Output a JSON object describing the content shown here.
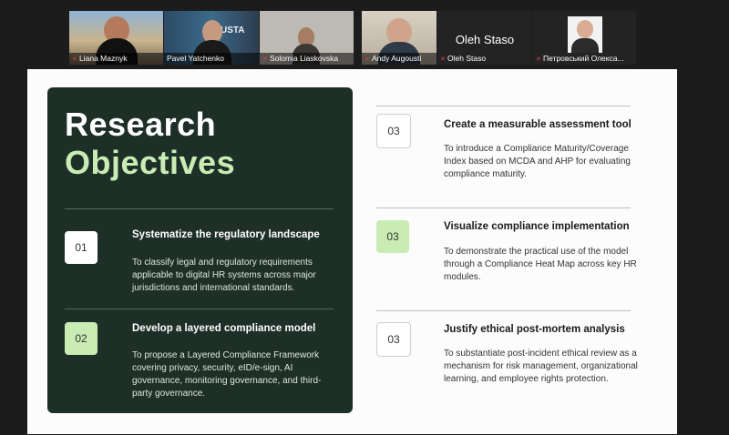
{
  "participants": [
    {
      "name": "Liana Maznyk",
      "muted": true
    },
    {
      "name": "Pavel Yatchenko",
      "muted": false,
      "active": true,
      "sign_text": "USTA"
    },
    {
      "name": "Solomia Liaskovska",
      "muted": true
    },
    {
      "name": "Andy Augousti",
      "muted": true
    },
    {
      "name": "Oleh Staso",
      "muted": true,
      "display_name": "Oleh Staso"
    },
    {
      "name": "Петровський Олекса...",
      "muted": true
    }
  ],
  "slide": {
    "title_line1": "Research",
    "title_line2": "Objectives",
    "left_items": [
      {
        "number": "01",
        "title": "Systematize the regulatory landscape",
        "description": "To classify legal and regulatory requirements applicable to digital HR systems across major jurisdictions and international standards."
      },
      {
        "number": "02",
        "title": "Develop a layered compliance model",
        "description": "To propose a Layered Compliance Framework covering privacy, security, eID/e-sign, AI governance, monitoring governance, and third-party governance."
      }
    ],
    "right_items": [
      {
        "number": "03",
        "title": "Create a measurable assessment tool",
        "description": "To introduce a Compliance Maturity/Coverage Index based on MCDA and AHP for evaluating compliance maturity."
      },
      {
        "number": "03",
        "title": "Visualize compliance implementation",
        "description": "To demonstrate the practical use of the model through a Compliance Heat Map across key HR modules."
      },
      {
        "number": "03",
        "title": "Justify ethical post-mortem analysis",
        "description": "To substantiate post-incident ethical review as a mechanism for risk management, organizational learning, and employee rights protection."
      }
    ]
  },
  "colors": {
    "panel_bg": "#1e2f27",
    "accent_green": "#c8ecb3",
    "active_speaker": "#37b34a",
    "muted_mic": "#e0413a"
  }
}
